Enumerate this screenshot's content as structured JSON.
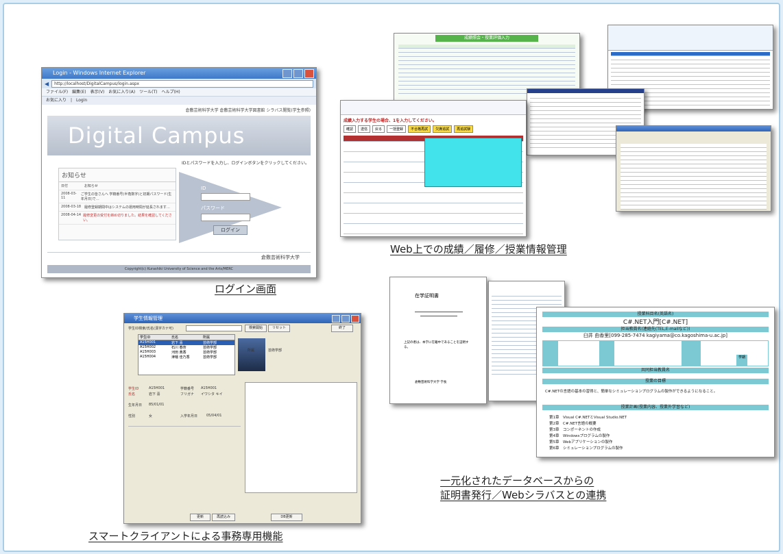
{
  "captions": {
    "login": "ログイン画面",
    "web": "Web上での成績／履修／授業情報管理",
    "smart_client": "スマートクライアントによる事務専用機能",
    "unified_line1": "一元化されたデータベースからの",
    "unified_line2": "証明書発行／Webシラバスとの連携"
  },
  "login_window": {
    "title": "Login - Windows Internet Explorer",
    "address": "http://localhost/DigitalCampus/login.aspx",
    "menu": "ファイル(F)　編集(E)　表示(V)　お気に入り(A)　ツール(T)　ヘルプ(H)",
    "favorites": "お気に入り　|　Login",
    "top_links": "倉敷芸術科学大学  倉敷芸術科学大学図書館  シラバス閲覧(学生参照)",
    "banner": "Digital Campus",
    "hint": "IDとパスワードを入力し、ログインボタンをクリックしてください。",
    "news_heading": "お知らせ",
    "news_col_date": "日付",
    "news_col_body": "お知らせ",
    "news_rows": [
      {
        "date": "2008-03-11",
        "text": "ご学生の皆さんへ 学籍番号(半角数字)と初期パスワード(生年月日)で…"
      },
      {
        "date": "2008-03-18",
        "text": "履修登録期間中はシステムの運用時間が延長されます…"
      },
      {
        "date": "2008-04-14",
        "text": "履修変更の受付を締め切りました。結果を確認してください。"
      }
    ],
    "id_label": "ID",
    "password_label": "パスワード",
    "login_button": "ログイン",
    "footer_org": "倉敷芸術科学大学",
    "copyright": "Copyright(c) Kurashiki University of Science and the Arts/MERC"
  },
  "web_screens": {
    "header_bar": "成績照会・授業評価入力",
    "entry_note": "成績入力する学生の場合、1を入力してください。",
    "tabs": [
      "確認",
      "送信",
      "戻る",
      "一括登録",
      "不合格再試",
      "欠席追試",
      "再追試験"
    ]
  },
  "student_form": {
    "title": "学生情報管理",
    "search_label": "学生ID検索/氏名(漢字カナ可)",
    "search_button": "検索開始",
    "reset_button": "リセット",
    "close_button": "終了",
    "list_headers": [
      "学生ID",
      "氏名",
      "所属"
    ],
    "list_rows": [
      [
        "A15H001",
        "岩下 喜",
        "芸術学部"
      ],
      [
        "A15H002",
        "石川 春奈",
        "芸術学部"
      ],
      [
        "A15H003",
        "河田 典香",
        "芸術学部"
      ],
      [
        "A15H004",
        "津幡 佳乃香",
        "芸術学部"
      ]
    ],
    "detail_labels": [
      "学生ID",
      "氏名",
      "学籍番号",
      "フリガナ",
      "生年月日",
      "性別",
      "入学年月日",
      "所属"
    ],
    "detail_values": [
      "A15H001",
      "岩下 喜",
      "A15H001",
      "イワシタ キイ",
      "85/01/01",
      "女",
      "05/04/01",
      "芸術学部"
    ],
    "update_button": "更新",
    "reload_button": "再読込み",
    "print_button": "DB更新"
  },
  "certificate": {
    "title": "在学証明書",
    "body": "上記の者は、本学に在籍中であることを証明する。",
    "issuer": "倉敷芸術科学大学 学長"
  },
  "syllabus": {
    "course_band": "授業科目名(英語名)",
    "course_name": "C#.NET入門[C#.NET]",
    "teacher_band": "担当教員名(連絡先(TEL,E-mailなど))",
    "teacher": "臼井 由香里[099-285-7474 kagiyama@co.kagoshima-u.ac.jp]",
    "term_label": "学期",
    "shared_teacher_band": "共同担当教員名",
    "goal_band": "授業の目標",
    "goal_text": "C#.NETの言語の基本の習得と、簡単なシミュレーションプログラムの製作ができるようになること。",
    "plan_band": "授業計画(授業内容、授業外学習など)",
    "plan_items": [
      "第1章　Visual C#.NETとVisual Studio.NET",
      "第2章　C#.NET言語の概要",
      "第3章　コンポーネントの作成",
      "第4章　Windowsプログラムの製作",
      "第5章　Webアプリケーションの製作",
      "第6章　シミュレーションプログラムの製作"
    ]
  }
}
